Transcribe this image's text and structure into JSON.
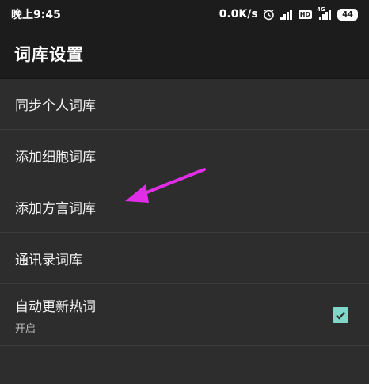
{
  "status_bar": {
    "time": "晚上9:45",
    "speed": "0.0K/s",
    "hd_badge": "HD",
    "network": "4G",
    "battery": "44",
    "icons": [
      "alarm-icon",
      "signal-icon",
      "hd-icon",
      "4g-signal-icon",
      "battery-icon"
    ]
  },
  "app_bar": {
    "title": "词库设置"
  },
  "settings": {
    "items": [
      {
        "label": "同步个人词库"
      },
      {
        "label": "添加细胞词库"
      },
      {
        "label": "添加方言词库"
      },
      {
        "label": "通讯录词库"
      },
      {
        "label": "自动更新热词",
        "summary": "开启",
        "checked": true
      }
    ]
  },
  "colors": {
    "background": "#2d2d2d",
    "app_bar": "#1c1c1c",
    "checkbox": "#7fd6c9",
    "annotation_arrow": "#e02ee8"
  }
}
